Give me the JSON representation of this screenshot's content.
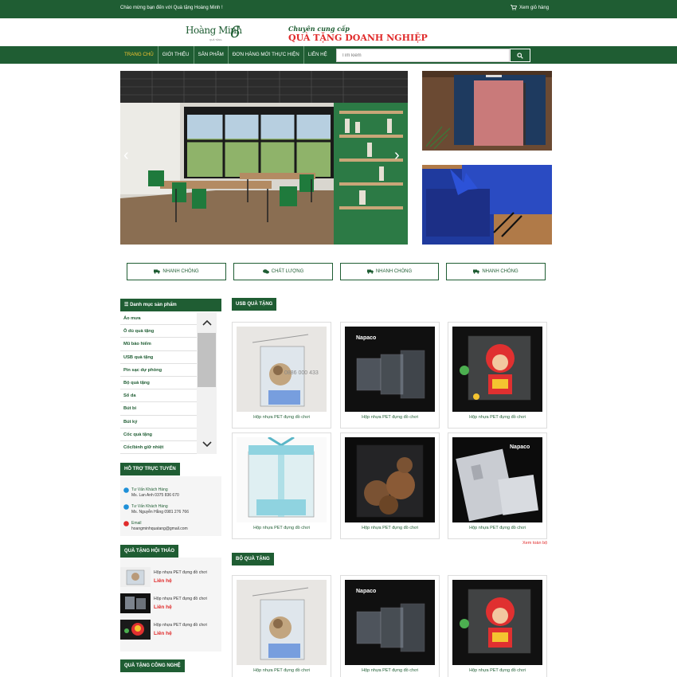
{
  "topbar": {
    "welcome": "Chào mừng bạn đến với Quà tặng Hoàng Minh !",
    "cart": "Xem giỏ hàng"
  },
  "header": {
    "logo_text": "Hoàng Minh",
    "logo_sub": "QUÀ TẶNG",
    "logo_mark": "6",
    "tagline1": "Chuyên cung cấp",
    "tagline2": "QUÀ TẶNG DOANH NGHIỆP"
  },
  "nav": {
    "items": [
      "TRANG CHỦ",
      "GIỚI THIỆU",
      "SẢN PHẨM",
      "ĐƠN HÀNG MỚI THỰC HIỆN",
      "LIÊN HỆ"
    ]
  },
  "search": {
    "placeholder": "Tìm kiếm"
  },
  "features": [
    "NHANH CHÓNG",
    "CHẤT LƯỢNG",
    "NHANH CHÓNG",
    "NHANH CHÓNG"
  ],
  "categories": {
    "title": "Danh mục sản phẩm",
    "items": [
      "Áo mưa",
      "Ô dù quà tặng",
      "Mũ bảo hiểm",
      "USB quà tặng",
      "Pin sạc dự phòng",
      "Bộ quà tặng",
      "Sổ da",
      "Bút bi",
      "Bút ký",
      "Cốc quà tặng",
      "Cốc/bình giữ nhiệt"
    ]
  },
  "support": {
    "title": "HỖ TRỢ TRỰC TUYẾN",
    "items": [
      {
        "role": "Tư Vấn Khách Hàng",
        "contact": "Ms. Lan Anh 0375 836 670"
      },
      {
        "role": "Tư Vấn Khách Hàng",
        "contact": "Ms. Nguyễn Hằng 0981 276 766"
      },
      {
        "role": "Email",
        "contact": "hoangminhquatang@gmail.com"
      }
    ]
  },
  "gift_conference": {
    "title": "QUÀ TẶNG HỘI THẢO",
    "items": [
      {
        "name": "Hộp nhựa PET đựng đồ chơi",
        "price": "Liên hệ"
      },
      {
        "name": "Hộp nhựa PET đựng đồ chơi",
        "price": "Liên hệ"
      },
      {
        "name": "Hộp nhựa PET đựng đồ chơi",
        "price": "Liên hệ"
      }
    ]
  },
  "gift_tech": {
    "title": "QUÀ TẶNG CÔNG NGHỆ"
  },
  "usb_section": {
    "title": "USB QUÀ TẶNG",
    "products": [
      "Hộp nhựa PET đựng đồ chơi",
      "Hộp nhựa PET đựng đồ chơi",
      "Hộp nhựa PET đựng đồ chơi",
      "Hộp nhựa PET đựng đồ chơi",
      "Hộp nhựa PET đựng đồ chơi",
      "Hộp nhựa PET đựng đồ chơi"
    ],
    "view_all": "Xem toàn bộ"
  },
  "set_section": {
    "title": "BỘ QUÀ TẶNG",
    "products": [
      "Hộp nhựa PET đựng đồ chơi",
      "Hộp nhựa PET đựng đồ chơi",
      "Hộp nhựa PET đựng đồ chơi"
    ]
  },
  "image_text": {
    "brand": "Napaco",
    "watermark": "0886 000 433"
  },
  "colors": {
    "primary": "#1f5d33",
    "accent": "#e02b2b",
    "active_nav": "#f4c430"
  }
}
